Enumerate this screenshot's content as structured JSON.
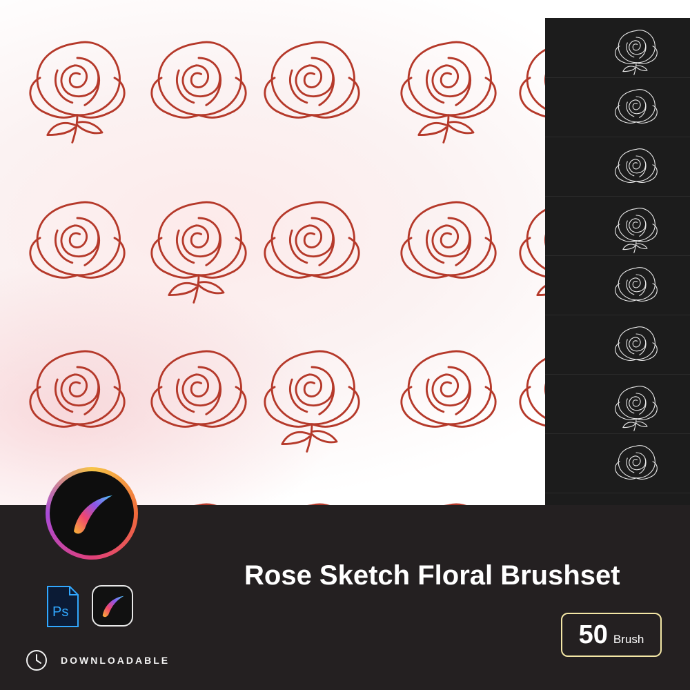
{
  "title": "Rose Sketch Floral Brushset",
  "brush_count": {
    "number": "50",
    "unit": "Brush"
  },
  "download_label": "DOWNLOADABLE",
  "icons": {
    "main_app": "procreate-logo-icon",
    "photoshop": "photoshop-icon",
    "procreate_small": "procreate-icon",
    "clock": "clock-icon"
  },
  "colors": {
    "rose_stroke": "#b5392a",
    "bottom_bar": "#242021",
    "panel": "#1c1c1c",
    "badge_border": "#f4e7a6",
    "ps_blue": "#31a8ff"
  },
  "photoshop_label": "Ps"
}
